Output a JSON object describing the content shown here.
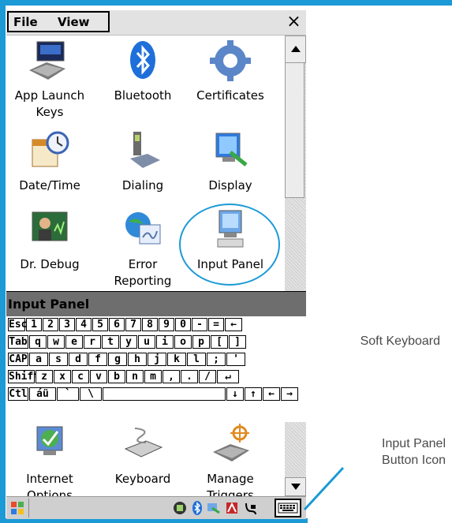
{
  "menubar": {
    "file_label": "File",
    "view_label": "View",
    "close_label": "×"
  },
  "icons": [
    {
      "label1": "App Launch",
      "label2": "Keys",
      "icon": "app-launch-keys-icon"
    },
    {
      "label1": "Bluetooth",
      "label2": "",
      "icon": "bluetooth-icon"
    },
    {
      "label1": "Certificates",
      "label2": "",
      "icon": "certificates-icon"
    },
    {
      "label1": "Date/Time",
      "label2": "",
      "icon": "date-time-icon"
    },
    {
      "label1": "Dialing",
      "label2": "",
      "icon": "dialing-icon"
    },
    {
      "label1": "Display",
      "label2": "",
      "icon": "display-icon"
    },
    {
      "label1": "Dr. Debug",
      "label2": "",
      "icon": "dr-debug-icon"
    },
    {
      "label1": "Error",
      "label2": "Reporting",
      "icon": "error-reporting-icon"
    },
    {
      "label1": "Input Panel",
      "label2": "",
      "icon": "input-panel-icon"
    }
  ],
  "lower_icons": [
    {
      "label1": "Internet",
      "label2": "Options",
      "icon": "internet-options-icon"
    },
    {
      "label1": "Keyboard",
      "label2": "",
      "icon": "keyboard-icon"
    },
    {
      "label1": "Manage",
      "label2": "Triggers",
      "icon": "manage-triggers-icon"
    }
  ],
  "input_panel": {
    "title": "Input Panel",
    "rows": [
      [
        "Esc",
        "1",
        "2",
        "3",
        "4",
        "5",
        "6",
        "7",
        "8",
        "9",
        "0",
        "-",
        "=",
        "←"
      ],
      [
        "Tab",
        "q",
        "w",
        "e",
        "r",
        "t",
        "y",
        "u",
        "i",
        "o",
        "p",
        "[",
        "]"
      ],
      [
        "CAP",
        "a",
        "s",
        "d",
        "f",
        "g",
        "h",
        "j",
        "k",
        "l",
        ";",
        "'"
      ],
      [
        "Shift",
        "z",
        "x",
        "c",
        "v",
        "b",
        "n",
        "m",
        ",",
        ".",
        "/",
        "↵"
      ],
      [
        "Ctl",
        "áü",
        "`",
        "\\",
        "",
        "↓",
        "↑",
        "←",
        "→"
      ]
    ]
  },
  "annotations": {
    "soft_keyboard": "Soft Keyboard",
    "input_panel_button_line1": "Input Panel",
    "input_panel_button_line2": "Button Icon"
  },
  "colors": {
    "accent": "#1b9ad6",
    "panel_header": "#6e6e6e",
    "taskbar": "#cfcfcf"
  }
}
